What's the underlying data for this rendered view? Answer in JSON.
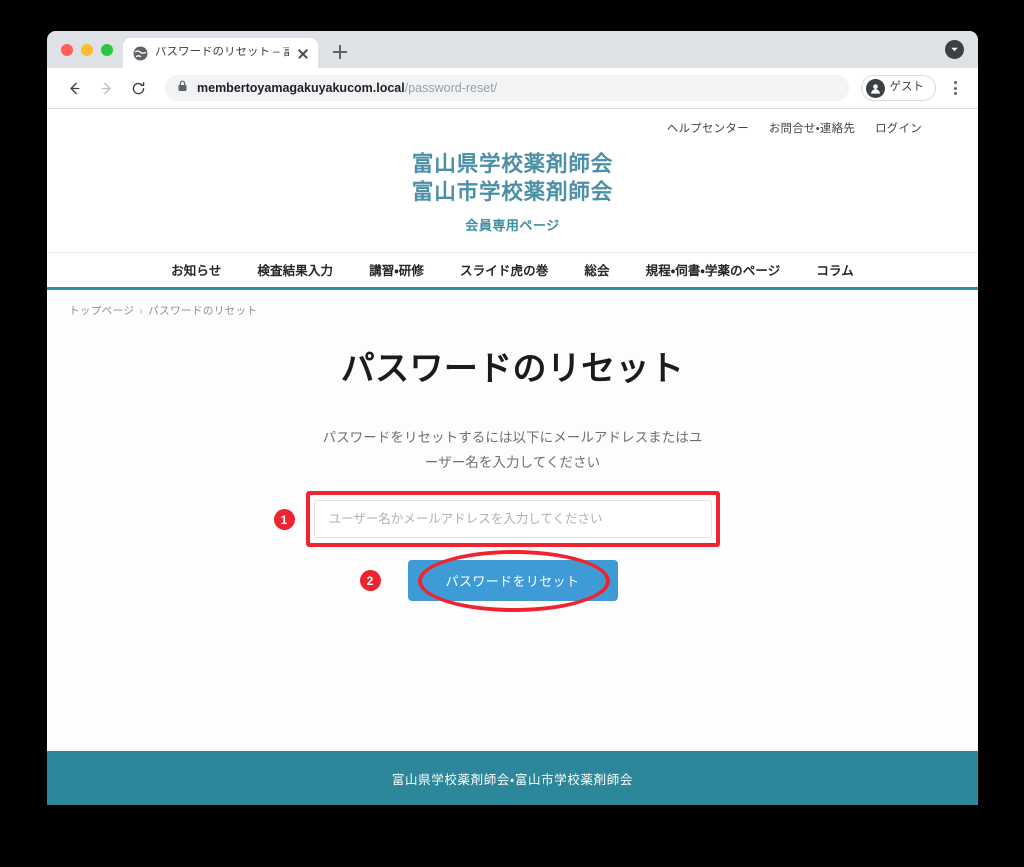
{
  "browser": {
    "tab": {
      "title": "パスワードのリセット – 富山県学校",
      "favicon_icon": "globe-icon",
      "close_icon": "close-icon"
    },
    "new_tab_icon": "plus-icon",
    "download_indicator_icon": "chevron-down-circle-icon",
    "back_icon": "arrow-left-icon",
    "forward_icon": "arrow-right-icon",
    "reload_icon": "reload-icon",
    "address": {
      "lock_icon": "lock-icon",
      "host": "membertoyamagakuyakucom.local",
      "path": "/password-reset/"
    },
    "profile": {
      "avatar_icon": "person-icon",
      "label": "ゲスト"
    },
    "menu_icon": "kebab-menu-icon"
  },
  "site": {
    "utility_nav": [
      {
        "label": "ヘルプセンター"
      },
      {
        "label": "お問合せ・連絡先"
      },
      {
        "label": "ログイン"
      }
    ],
    "brand": {
      "line1": "富山県学校薬剤師会",
      "line2": "富山市学校薬剤師会",
      "subtitle": "会員専用ページ"
    },
    "main_nav": [
      {
        "label": "お知らせ"
      },
      {
        "label": "検査結果入力"
      },
      {
        "label": "講習・研修"
      },
      {
        "label": "スライド虎の巻"
      },
      {
        "label": "総会"
      },
      {
        "label": "規程・伺書・学薬のページ"
      },
      {
        "label": "コラム"
      }
    ],
    "breadcrumb": {
      "home": "トップページ",
      "separator": "›",
      "current": "パスワードのリセット"
    },
    "page": {
      "title": "パスワードのリセット",
      "description": "パスワードをリセットするには以下にメールアドレスまたはユーザー名を入力してください",
      "input": {
        "placeholder": "ユーザー名かメールアドレスを入力してください",
        "value": ""
      },
      "submit_label": "パスワードをリセット"
    },
    "footer": {
      "text": "富山県学校薬剤師会・富山市学校薬剤師会"
    }
  },
  "annotations": {
    "badge1": "1",
    "badge2": "2",
    "color": "#ee2530"
  },
  "colors": {
    "brand_teal": "#4b90a7",
    "nav_underline": "#2e8fa5",
    "button_blue": "#3f9bd6",
    "footer_teal": "#2b8799",
    "annotation_red": "#ee2530"
  }
}
